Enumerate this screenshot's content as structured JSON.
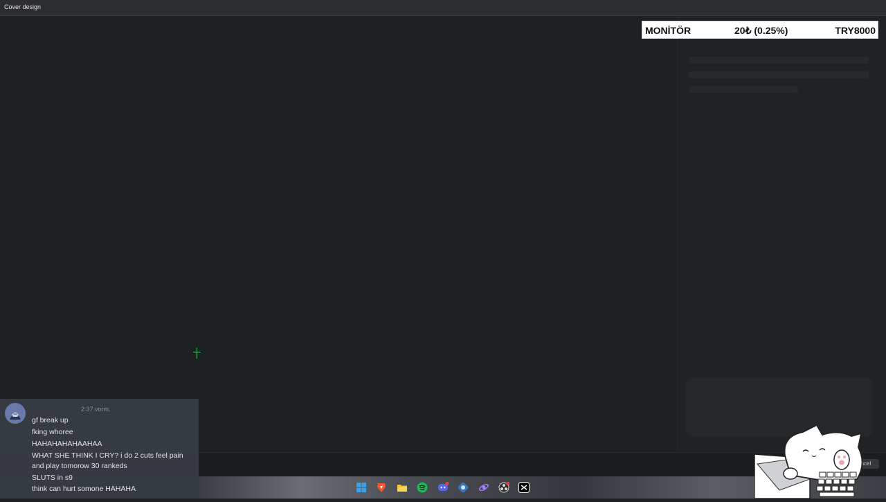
{
  "window": {
    "title": "Cover design"
  },
  "monitor": {
    "label": "MONİTÖR",
    "change": "20₺ (0.25%)",
    "price": "TRY8000"
  },
  "footer": {
    "cancel_label": "ncel"
  },
  "chat": {
    "username": "",
    "time": "2:37 vorm.",
    "messages": [
      "gf break up",
      "fking whoree",
      "HAHAHAHAHAAHAA",
      "WHAT SHE THINK I CRY?  i do 2 cuts feel pain",
      "and play tomorow 30 rankeds",
      "SLUTS in s9",
      "think can hurt somone HAHAHA"
    ]
  },
  "taskbar": {
    "icons": [
      "windows-start-icon",
      "brave-icon",
      "file-explorer-icon",
      "spotify-icon",
      "discord-icon",
      "app-icon",
      "app-purple-icon",
      "obs-icon",
      "capcut-icon"
    ]
  },
  "colors": {
    "accent_green": "#4cc870",
    "discord_username": "#3d52d8",
    "spotify": "#1db954",
    "discord": "#5865f2",
    "brave": "#fb542b",
    "explorer": "#f4c430"
  }
}
